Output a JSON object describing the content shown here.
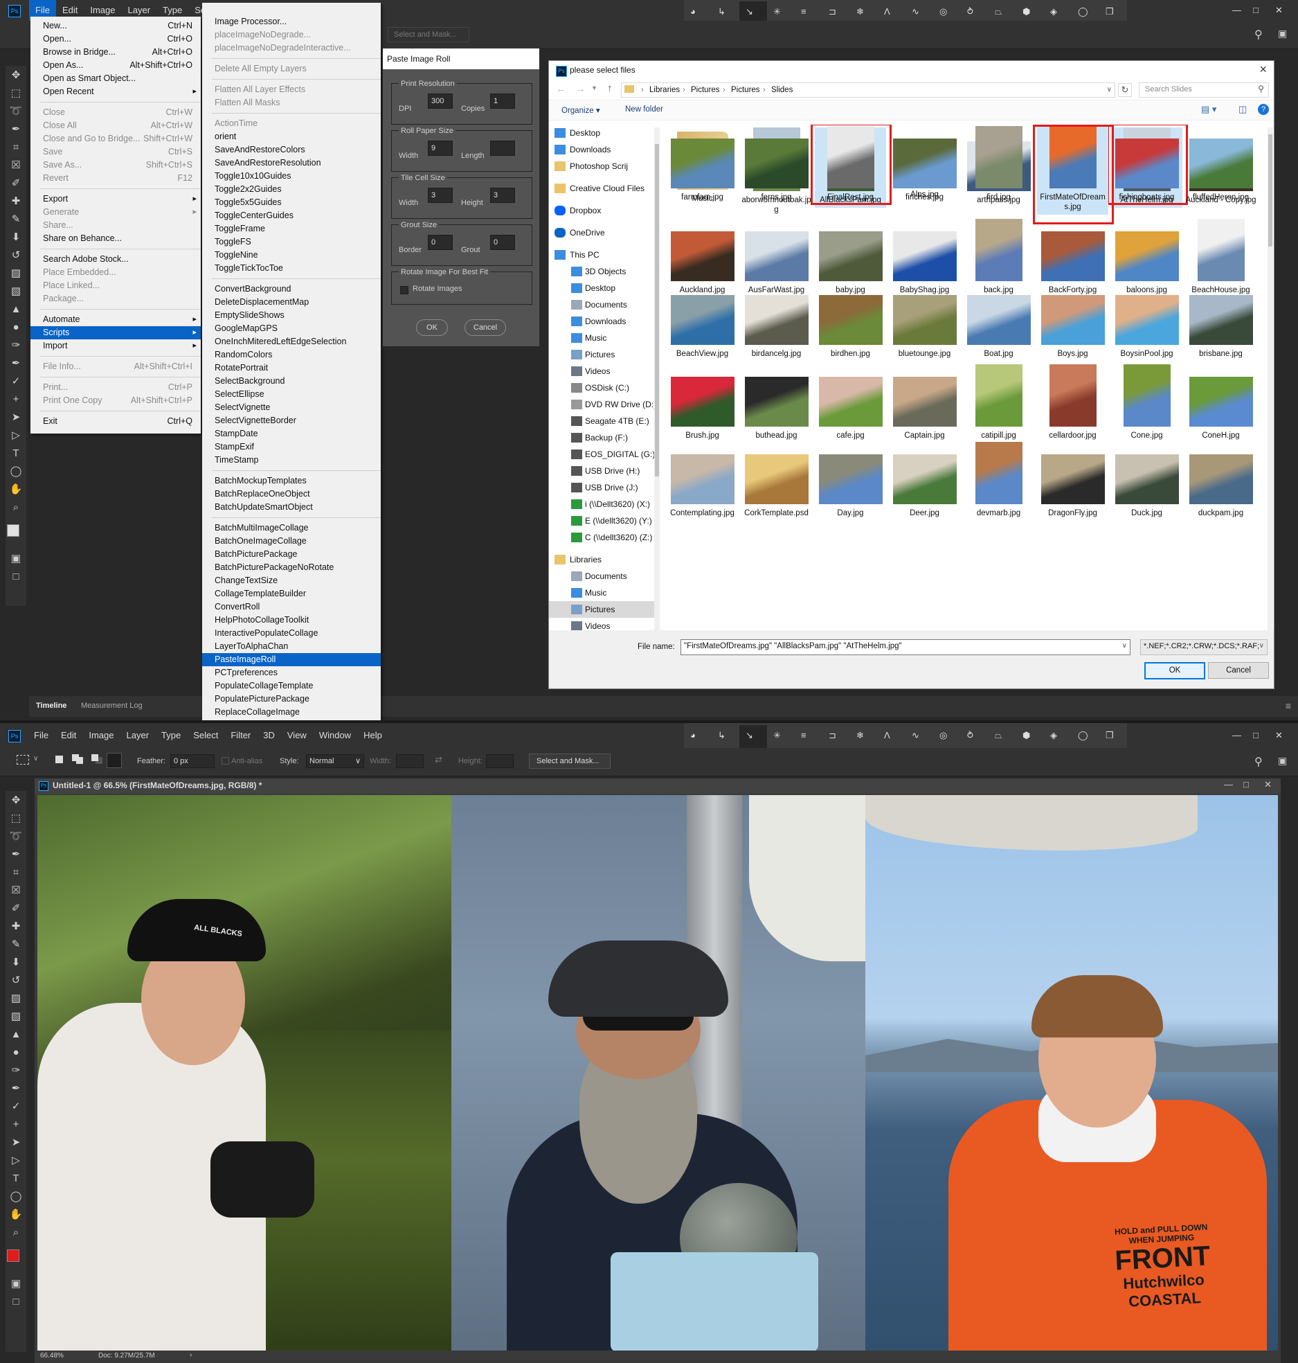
{
  "top": {
    "menubar": [
      "File",
      "Edit",
      "Image",
      "Layer",
      "Type",
      "Select"
    ],
    "select_mask": "Select and Mask...",
    "panel_tabs": [
      "Timeline",
      "Measurement Log"
    ]
  },
  "file_menu": {
    "items": [
      {
        "label": "New...",
        "shortcut": "Ctrl+N",
        "state": "normal"
      },
      {
        "label": "Open...",
        "shortcut": "Ctrl+O",
        "state": "normal"
      },
      {
        "label": "Browse in Bridge...",
        "shortcut": "Alt+Ctrl+O",
        "state": "normal"
      },
      {
        "label": "Open As...",
        "shortcut": "Alt+Shift+Ctrl+O",
        "state": "normal"
      },
      {
        "label": "Open as Smart Object...",
        "shortcut": "",
        "state": "normal"
      },
      {
        "label": "Open Recent",
        "shortcut": "",
        "state": "sub"
      },
      {
        "sep": true
      },
      {
        "label": "Close",
        "shortcut": "Ctrl+W",
        "state": "dis"
      },
      {
        "label": "Close All",
        "shortcut": "Alt+Ctrl+W",
        "state": "dis"
      },
      {
        "label": "Close and Go to Bridge...",
        "shortcut": "Shift+Ctrl+W",
        "state": "dis"
      },
      {
        "label": "Save",
        "shortcut": "Ctrl+S",
        "state": "dis"
      },
      {
        "label": "Save As...",
        "shortcut": "Shift+Ctrl+S",
        "state": "dis"
      },
      {
        "label": "Revert",
        "shortcut": "F12",
        "state": "dis"
      },
      {
        "sep": true
      },
      {
        "label": "Export",
        "shortcut": "",
        "state": "sub"
      },
      {
        "label": "Generate",
        "shortcut": "",
        "state": "dissub"
      },
      {
        "label": "Share...",
        "shortcut": "",
        "state": "dis"
      },
      {
        "label": "Share on Behance...",
        "shortcut": "",
        "state": "normal"
      },
      {
        "sep": true
      },
      {
        "label": "Search Adobe Stock...",
        "shortcut": "",
        "state": "normal"
      },
      {
        "label": "Place Embedded...",
        "shortcut": "",
        "state": "dis"
      },
      {
        "label": "Place Linked...",
        "shortcut": "",
        "state": "dis"
      },
      {
        "label": "Package...",
        "shortcut": "",
        "state": "dis"
      },
      {
        "sep": true
      },
      {
        "label": "Automate",
        "shortcut": "",
        "state": "sub"
      },
      {
        "label": "Scripts",
        "shortcut": "",
        "state": "selsub"
      },
      {
        "label": "Import",
        "shortcut": "",
        "state": "sub"
      },
      {
        "sep": true
      },
      {
        "label": "File Info...",
        "shortcut": "Alt+Shift+Ctrl+I",
        "state": "dis"
      },
      {
        "sep": true
      },
      {
        "label": "Print...",
        "shortcut": "Ctrl+P",
        "state": "dis"
      },
      {
        "label": "Print One Copy",
        "shortcut": "Alt+Shift+Ctrl+P",
        "state": "dis"
      },
      {
        "sep": true
      },
      {
        "label": "Exit",
        "shortcut": "Ctrl+Q",
        "state": "normal"
      }
    ]
  },
  "scripts_menu": {
    "items": [
      {
        "label": "Image Processor...",
        "state": "normal"
      },
      {
        "label": "placeImageNoDegrade...",
        "state": "dis"
      },
      {
        "label": "placeImageNoDegradeInteractive...",
        "state": "dis"
      },
      {
        "sep": true
      },
      {
        "label": "Delete All Empty Layers",
        "state": "dis"
      },
      {
        "sep": true
      },
      {
        "label": "Flatten All Layer Effects",
        "state": "dis"
      },
      {
        "label": "Flatten All Masks",
        "state": "dis"
      },
      {
        "sep": true
      },
      {
        "label": "ActionTime",
        "state": "dis"
      },
      {
        "label": "orient",
        "state": "normal"
      },
      {
        "label": "SaveAndRestoreColors",
        "state": "normal"
      },
      {
        "label": "SaveAndRestoreResolution",
        "state": "normal"
      },
      {
        "label": "Toggle10x10Guides",
        "state": "normal"
      },
      {
        "label": "Toggle2x2Guides",
        "state": "normal"
      },
      {
        "label": "Toggle5x5Guides",
        "state": "normal"
      },
      {
        "label": "ToggleCenterGuides",
        "state": "normal"
      },
      {
        "label": "ToggleFrame",
        "state": "normal"
      },
      {
        "label": "ToggleFS",
        "state": "normal"
      },
      {
        "label": "ToggleNine",
        "state": "normal"
      },
      {
        "label": "ToggleTickTocToe",
        "state": "normal"
      },
      {
        "sep": true
      },
      {
        "label": "ConvertBackground",
        "state": "normal"
      },
      {
        "label": "DeleteDisplacementMap",
        "state": "normal"
      },
      {
        "label": "EmptySlideShows",
        "state": "normal"
      },
      {
        "label": "GoogleMapGPS",
        "state": "normal"
      },
      {
        "label": "OneInchMiteredLeftEdgeSelection",
        "state": "normal"
      },
      {
        "label": "RandomColors",
        "state": "normal"
      },
      {
        "label": "RotatePortrait",
        "state": "normal"
      },
      {
        "label": "SelectBackground",
        "state": "normal"
      },
      {
        "label": "SelectEllipse",
        "state": "normal"
      },
      {
        "label": "SelectVignette",
        "state": "normal"
      },
      {
        "label": "SelectVignetteBorder",
        "state": "normal"
      },
      {
        "label": "StampDate",
        "state": "normal"
      },
      {
        "label": "StampExif",
        "state": "normal"
      },
      {
        "label": "TimeStamp",
        "state": "normal"
      },
      {
        "sep": true
      },
      {
        "label": "BatchMockupTemplates",
        "state": "normal"
      },
      {
        "label": "BatchReplaceOneObject",
        "state": "normal"
      },
      {
        "label": "BatchUpdateSmartObject",
        "state": "normal"
      },
      {
        "sep": true
      },
      {
        "label": "BatchMultiImageCollage",
        "state": "normal"
      },
      {
        "label": "BatchOneImageCollage",
        "state": "normal"
      },
      {
        "label": "BatchPicturePackage",
        "state": "normal"
      },
      {
        "label": "BatchPicturePackageNoRotate",
        "state": "normal"
      },
      {
        "label": "ChangeTextSize",
        "state": "normal"
      },
      {
        "label": "CollageTemplateBuilder",
        "state": "normal"
      },
      {
        "label": "ConvertRoll",
        "state": "normal"
      },
      {
        "label": "HelpPhotoCollageToolkit",
        "state": "normal"
      },
      {
        "label": "InteractivePopulateCollage",
        "state": "normal"
      },
      {
        "label": "LayerToAlphaChan",
        "state": "normal"
      },
      {
        "label": "PasteImageRoll",
        "state": "sel"
      },
      {
        "label": "PCTpreferences",
        "state": "normal"
      },
      {
        "label": "PopulateCollageTemplate",
        "state": "normal"
      },
      {
        "label": "PopulatePicturePackage",
        "state": "normal"
      },
      {
        "label": "ReplaceCollageImage",
        "state": "normal"
      }
    ]
  },
  "paste_dialog": {
    "title": "Paste Image Roll",
    "print_resolution": "Print Resolution",
    "dpi_label": "DPI",
    "dpi": "300",
    "copies_label": "Copies",
    "copies": "1",
    "roll_paper": "Roll Paper Size",
    "width_label": "Width",
    "paper_width": "9",
    "length_label": "Length",
    "paper_length": "",
    "tile_cell": "Tile Cell Size",
    "tile_width": "3",
    "height_label": "Height",
    "tile_height": "3",
    "grout_size": "Grout Size",
    "border_label": "Border",
    "border": "0",
    "grout_label": "Grout",
    "grout": "0",
    "rotate_group": "Rotate Image For Best Fit",
    "rotate_check": "Rotate Images",
    "ok": "OK",
    "cancel": "Cancel"
  },
  "file_dialog": {
    "title": "please select files",
    "breadcrumb": [
      "Libraries",
      "Pictures",
      "Pictures",
      "Slides"
    ],
    "search_placeholder": "Search Slides",
    "organize": "Organize",
    "new_folder": "New folder",
    "nav": [
      {
        "label": "Desktop",
        "icon": "desktop-folder",
        "pin": true
      },
      {
        "label": "Downloads",
        "icon": "downloads",
        "pin": true
      },
      {
        "label": "Photoshop Scrij",
        "icon": "folder",
        "pin": true
      },
      {
        "gap": true
      },
      {
        "label": "Creative Cloud Files",
        "icon": "cc"
      },
      {
        "gap": true
      },
      {
        "label": "Dropbox",
        "icon": "dropbox"
      },
      {
        "gap": true
      },
      {
        "label": "OneDrive",
        "icon": "onedrive"
      },
      {
        "gap": true
      },
      {
        "label": "This PC",
        "icon": "pc"
      },
      {
        "label": "3D Objects",
        "icon": "folder3d",
        "indent": true
      },
      {
        "label": "Desktop",
        "icon": "desktop-folder",
        "indent": true
      },
      {
        "label": "Documents",
        "icon": "docs",
        "indent": true
      },
      {
        "label": "Downloads",
        "icon": "downloads",
        "indent": true
      },
      {
        "label": "Music",
        "icon": "music",
        "indent": true
      },
      {
        "label": "Pictures",
        "icon": "pics",
        "indent": true
      },
      {
        "label": "Videos",
        "icon": "videos",
        "indent": true
      },
      {
        "label": "OSDisk (C:)",
        "icon": "drive",
        "indent": true
      },
      {
        "label": "DVD RW Drive (D:)",
        "icon": "dvd",
        "indent": true
      },
      {
        "label": "Seagate 4TB (E:)",
        "icon": "drive2",
        "indent": true
      },
      {
        "label": "Backup (F:)",
        "icon": "drive2",
        "indent": true
      },
      {
        "label": "EOS_DIGITAL (G:)",
        "icon": "drive2",
        "indent": true
      },
      {
        "label": "USB Drive (H:)",
        "icon": "drive2",
        "indent": true
      },
      {
        "label": "USB Drive (J:)",
        "icon": "drive2",
        "indent": true
      },
      {
        "label": "i (\\\\Dellt3620) (X:)",
        "icon": "net",
        "indent": true
      },
      {
        "label": "E (\\\\dellt3620) (Y:)",
        "icon": "net",
        "indent": true
      },
      {
        "label": "C (\\\\dellt3620) (Z:)",
        "icon": "net",
        "indent": true
      },
      {
        "gap": true
      },
      {
        "label": "Libraries",
        "icon": "libs"
      },
      {
        "label": "Documents",
        "icon": "docs",
        "indent": true
      },
      {
        "label": "Music",
        "icon": "music",
        "indent": true
      },
      {
        "label": "Pictures",
        "icon": "pics",
        "indent": true,
        "selected": true
      },
      {
        "label": "Videos",
        "icon": "videos",
        "indent": true
      }
    ],
    "files": [
      {
        "name": "Music",
        "colors": [
          "#d9b36a",
          "#e9d39a"
        ],
        "kind": "folder"
      },
      {
        "name": "aborwomnoutbak.jpg",
        "colors": [
          "#6f8a4b",
          "#b7c8d8"
        ],
        "kind": "portrait"
      },
      {
        "name": "AllBlacksPam.jpg",
        "colors": [
          "#3b5a33",
          "#9bb07a"
        ],
        "kind": "portrait",
        "selected": true
      },
      {
        "name": "Alps.jpg",
        "colors": [
          "#3b6fb0",
          "#dfe8ee"
        ],
        "kind": "pano"
      },
      {
        "name": "arthpass.jpg",
        "colors": [
          "#3d5a7f",
          "#dde4ea"
        ],
        "kind": "land"
      },
      {
        "name": "athrpass.jpg",
        "colors": [
          "#3c597c",
          "#d8e0e6"
        ],
        "kind": "land"
      },
      {
        "name": "AtTheHelm.jpg",
        "colors": [
          "#4d5a66",
          "#c9d4df"
        ],
        "kind": "portrait",
        "selected": true
      },
      {
        "name": "Auckland - Copy.jpg",
        "colors": [
          "#3a2e24",
          "#c65a3c"
        ],
        "kind": "land"
      },
      {
        "name": "Auckland.jpg",
        "colors": [
          "#382c22",
          "#c25a38"
        ],
        "kind": "land"
      },
      {
        "name": "AusFarWast.jpg",
        "colors": [
          "#5c7aa6",
          "#d8e0e8"
        ],
        "kind": "land"
      },
      {
        "name": "baby.jpg",
        "colors": [
          "#4e5a3a",
          "#9a9d8a"
        ],
        "kind": "land"
      },
      {
        "name": "BabyShag.jpg",
        "colors": [
          "#1e4fa8",
          "#e8e8e8"
        ],
        "kind": "land"
      },
      {
        "name": "back.jpg",
        "colors": [
          "#5c7cb8",
          "#b8a88a"
        ],
        "kind": "portrait"
      },
      {
        "name": "BackForty.jpg",
        "colors": [
          "#3f6fb5",
          "#a85a3a"
        ],
        "kind": "land"
      },
      {
        "name": "baloons.jpg",
        "colors": [
          "#4f86c6",
          "#e0a23a"
        ],
        "kind": "land"
      },
      {
        "name": "BeachHouse.jpg",
        "colors": [
          "#6a8ab2",
          "#f0f0f0"
        ],
        "kind": "portrait"
      },
      {
        "name": "BeachView.jpg",
        "colors": [
          "#2f6fa8",
          "#8aa0a8"
        ],
        "kind": "land"
      },
      {
        "name": "birdancelg.jpg",
        "colors": [
          "#5c5c4e",
          "#e4e0d8"
        ],
        "kind": "land"
      },
      {
        "name": "birdhen.jpg",
        "colors": [
          "#6b8a3a",
          "#8c6a3a"
        ],
        "kind": "land"
      },
      {
        "name": "bluetounge.jpg",
        "colors": [
          "#6a7a3a",
          "#a8a07a"
        ],
        "kind": "land"
      },
      {
        "name": "Boat.jpg",
        "colors": [
          "#4a7ab2",
          "#c9d8e4"
        ],
        "kind": "land"
      },
      {
        "name": "Boys.jpg",
        "colors": [
          "#4aa0d8",
          "#d09a7a"
        ],
        "kind": "land"
      },
      {
        "name": "BoysinPool.jpg",
        "colors": [
          "#4aa6dc",
          "#e0b08a"
        ],
        "kind": "land"
      },
      {
        "name": "brisbane.jpg",
        "colors": [
          "#3a4a3a",
          "#a8b8c8"
        ],
        "kind": "land"
      },
      {
        "name": "Brush.jpg",
        "colors": [
          "#2f5a2a",
          "#d8283a"
        ],
        "kind": "land"
      },
      {
        "name": "buthead.jpg",
        "colors": [
          "#6a8a4a",
          "#2a2a2a"
        ],
        "kind": "land"
      },
      {
        "name": "cafe.jpg",
        "colors": [
          "#6a9a3a",
          "#d8b8a8"
        ],
        "kind": "land"
      },
      {
        "name": "Captain.jpg",
        "colors": [
          "#6a6a5a",
          "#c8a888"
        ],
        "kind": "land"
      },
      {
        "name": "catipill.jpg",
        "colors": [
          "#6a9a3a",
          "#b8c87a"
        ],
        "kind": "portrait"
      },
      {
        "name": "cellardoor.jpg",
        "colors": [
          "#8a3a2a",
          "#c87a5a"
        ],
        "kind": "portrait"
      },
      {
        "name": "Cone.jpg",
        "colors": [
          "#5a88c8",
          "#7a9a3a"
        ],
        "kind": "portrait"
      },
      {
        "name": "ConeH.jpg",
        "colors": [
          "#5a8ad0",
          "#6a9a3a"
        ],
        "kind": "land"
      },
      {
        "name": "Contemplating.jpg",
        "colors": [
          "#8aa8c8",
          "#c8b8a8"
        ],
        "kind": "land"
      },
      {
        "name": "CorkTemplate.psd",
        "colors": [
          "#a8783a",
          "#e8c87a"
        ],
        "kind": "land"
      },
      {
        "name": "Day.jpg",
        "colors": [
          "#5a88c8",
          "#8a8a7a"
        ],
        "kind": "land"
      },
      {
        "name": "Deer.jpg",
        "colors": [
          "#4a7a3a",
          "#d8d0c0"
        ],
        "kind": "land"
      },
      {
        "name": "devmarb.jpg",
        "colors": [
          "#5a88c8",
          "#b87a4a"
        ],
        "kind": "portrait"
      },
      {
        "name": "DragonFly.jpg",
        "colors": [
          "#2a2a2a",
          "#b8a888"
        ],
        "kind": "land"
      },
      {
        "name": "Duck.jpg",
        "colors": [
          "#3a4a3a",
          "#c8c0b0"
        ],
        "kind": "land"
      },
      {
        "name": "duckpam.jpg",
        "colors": [
          "#4a6a8a",
          "#a89878"
        ],
        "kind": "land"
      },
      {
        "name": "farmfam.jpg",
        "colors": [
          "#5a88b8",
          "#6a8a3a"
        ],
        "kind": "land"
      },
      {
        "name": "ferns.jpg",
        "colors": [
          "#2a4a2a",
          "#5a7a3a"
        ],
        "kind": "land"
      },
      {
        "name": "FinalRest.jpg",
        "colors": [
          "#6a6a6a",
          "#e8e8e8"
        ],
        "kind": "portrait"
      },
      {
        "name": "finches.jpg",
        "colors": [
          "#6a9ad0",
          "#5a6a3a"
        ],
        "kind": "land"
      },
      {
        "name": "fird.jpg",
        "colors": [
          "#7a8a6a",
          "#a8a090"
        ],
        "kind": "portrait"
      },
      {
        "name": "FirstMateOfDreams.jpg",
        "colors": [
          "#4a7ab8",
          "#e86a2a"
        ],
        "kind": "portrait",
        "selected": true
      },
      {
        "name": "fishingboats.jpg",
        "colors": [
          "#5a88c8",
          "#c83a3a"
        ],
        "kind": "land"
      },
      {
        "name": "fluffedHeron.jpg",
        "colors": [
          "#4a7a3a",
          "#8ab8d8"
        ],
        "kind": "land"
      }
    ],
    "filename_label": "File name:",
    "filename_value": "\"FirstMateOfDreams.jpg\" \"AllBlacksPam.jpg\" \"AtTheHelm.jpg\"",
    "filter": "*.NEF;*.CR2;*.CRW;*.DCS;*.RAF;",
    "ok": "OK",
    "cancel": "Cancel"
  },
  "bottom": {
    "menubar": [
      "File",
      "Edit",
      "Image",
      "Layer",
      "Type",
      "Select",
      "Filter",
      "3D",
      "View",
      "Window",
      "Help"
    ],
    "feather_label": "Feather:",
    "feather": "0 px",
    "antialias": "Anti-alias",
    "style_label": "Style:",
    "style": "Normal",
    "width_label": "Width:",
    "height_label": "Height:",
    "select_mask": "Select and Mask...",
    "doc_title": "Untitled-1 @ 66.5% (FirstMateOfDreams.jpg, RGB/8) *",
    "zoom": "66.48%",
    "doc_info": "Doc: 9.27M/25.7M",
    "cap_text": "ALL BLACKS",
    "jacket_lines": [
      "HOLD and PULL DOWN",
      "WHEN JUMPING",
      "FRONT",
      "Hutchwilco",
      "COASTAL"
    ]
  },
  "colors": {
    "accent": "#0a64c8",
    "highlight_red": "#e21b1b",
    "foreground": "#e21b1b"
  }
}
